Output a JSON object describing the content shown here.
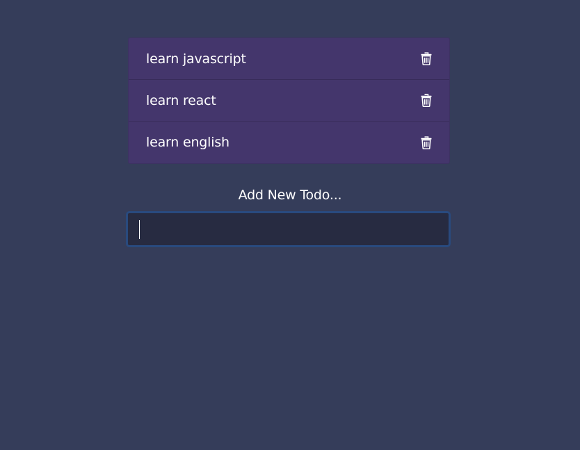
{
  "colors": {
    "background": "#353d5a",
    "list_background": "#44366c",
    "input_background": "#272b41",
    "input_border": "#294a7e",
    "text": "#ffffff"
  },
  "todos": [
    {
      "text": "learn javascript",
      "icon": "trash-icon"
    },
    {
      "text": "learn react",
      "icon": "trash-icon"
    },
    {
      "text": "learn english",
      "icon": "trash-icon"
    }
  ],
  "add_todo": {
    "label": "Add New Todo...",
    "value": ""
  }
}
